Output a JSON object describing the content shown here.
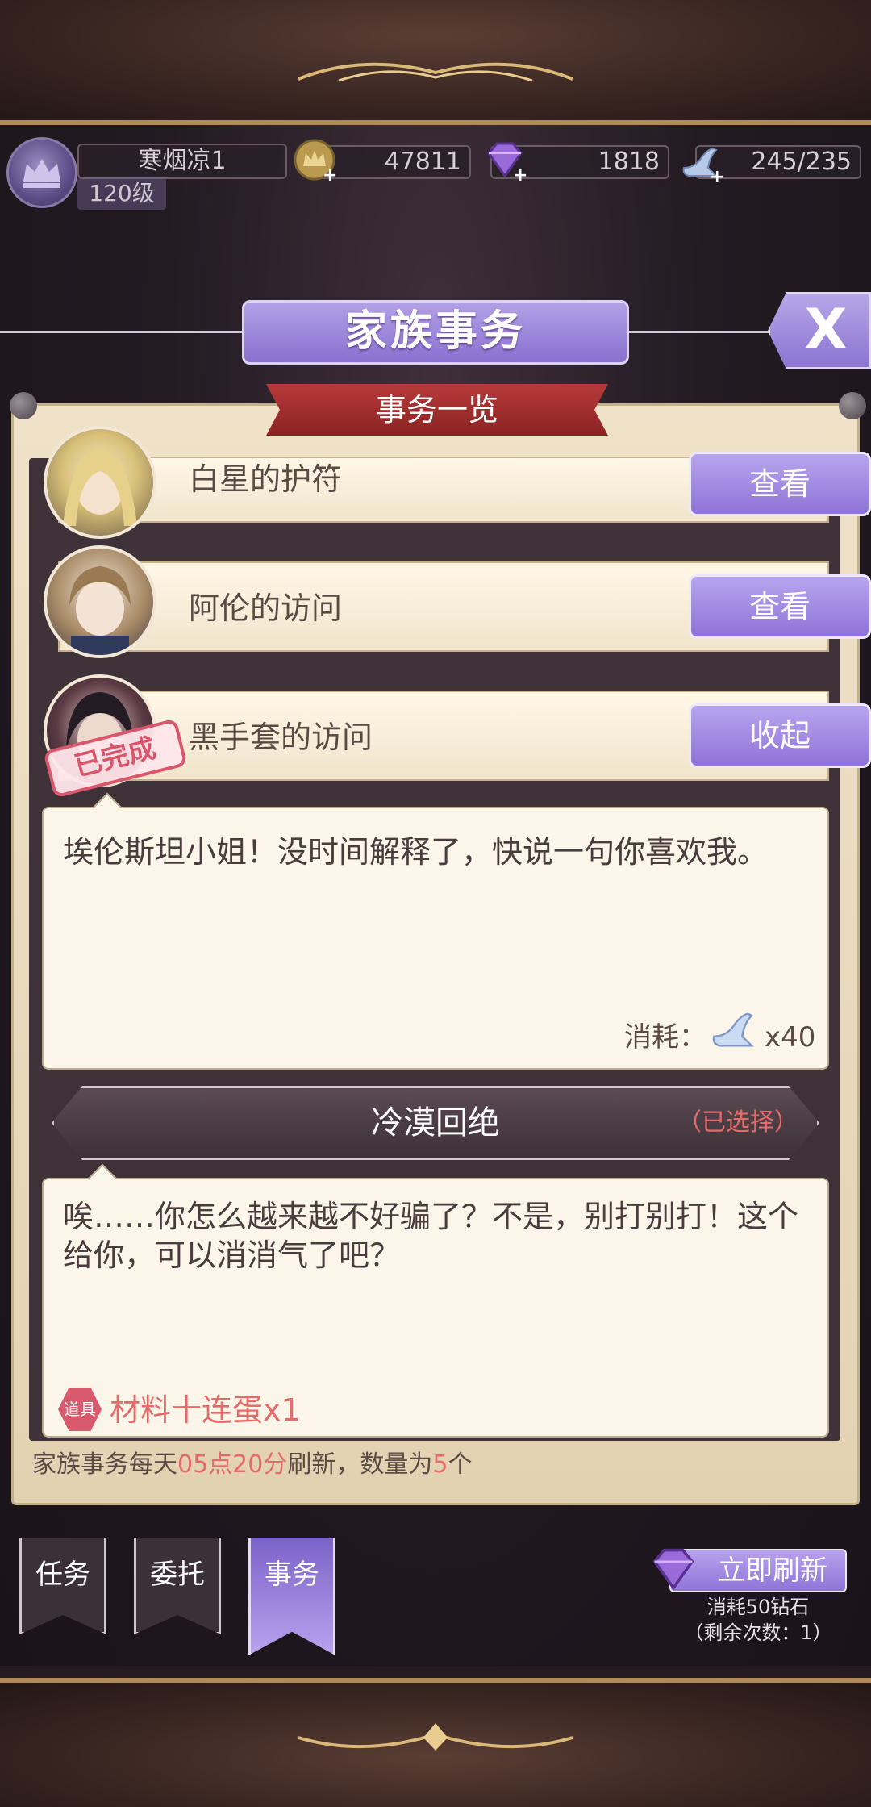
{
  "player": {
    "name": "寒烟凉1",
    "level": "120级"
  },
  "resources": {
    "gold": "47811",
    "diamonds": "1818",
    "stamina": "245/235"
  },
  "header": {
    "title": "家族事务",
    "close_label": "X"
  },
  "subtitle": "事务一览",
  "affairs": [
    {
      "title": "白星的护符",
      "button_label": "查看"
    },
    {
      "title": "阿伦的访问",
      "button_label": "查看"
    },
    {
      "title": "黑手套的访问",
      "button_label": "收起",
      "stamp": "已完成"
    }
  ],
  "dialog": {
    "prompt": "埃伦斯坦小姐！没时间解释了，快说一句你喜欢我。",
    "cost_label": "消耗：",
    "cost_amount": "x40",
    "choice": "冷漠回绝",
    "choice_status": "（已选择）",
    "reply": "唉……你怎么越来越不好骗了？不是，别打别打！这个给你，可以消消气了吧？",
    "reward_badge": "道具",
    "reward": "材料十连蛋x1"
  },
  "refresh_note": {
    "prefix": "家族事务每天",
    "time": "05点20分",
    "middle": "刷新，数量为",
    "count": "5",
    "suffix": "个"
  },
  "tabs": [
    {
      "label": "任务"
    },
    {
      "label": "委托"
    },
    {
      "label": "事务",
      "active": true
    }
  ],
  "refresh": {
    "button_label": "立即刷新",
    "cost": "消耗50钻石",
    "remaining": "（剩余次数：1）"
  },
  "colors": {
    "accent_purple": "#9b82e0",
    "highlight_red": "#e56b6b",
    "parchment": "#efe2c8"
  }
}
